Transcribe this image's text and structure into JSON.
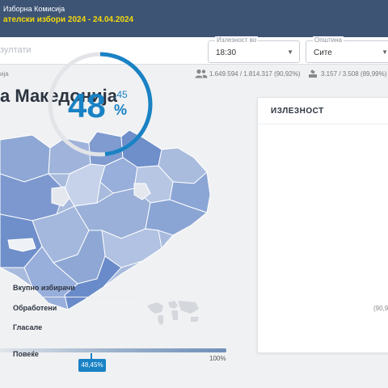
{
  "header": {
    "org": "Изборна Комисија",
    "election": "ателски избори 2024 - 24.04.2024"
  },
  "toolbar": {
    "results_label": "зултати",
    "turnout_select": {
      "label": "Излезност во",
      "value": "18:30"
    },
    "municipality_select": {
      "label": "Општина",
      "value": "Сите"
    }
  },
  "stats": {
    "region": "ија",
    "voters": "1.649.594 / 1.814.317 (90,92%)",
    "stations": "3.157 / 3.508 (89,99%)",
    "icons": [
      "people-icon",
      "ballot-box-icon"
    ]
  },
  "page_title": "а Македонија",
  "legend": {
    "max_label": "100%",
    "current_value": "48,45%",
    "current_fraction": 0.4845
  },
  "turnout_card": {
    "title": "ИЗЛЕЗНОСТ",
    "percent_int": "48",
    "percent_dec": ",45",
    "percent_sign": "%",
    "percent_value": 48.45,
    "rows": [
      {
        "label": "Вкупно избирачи",
        "value": ""
      },
      {
        "label": "Обработени",
        "value": "(90,9"
      },
      {
        "label": "Гласале",
        "value": ""
      },
      {
        "label": "Повеќе",
        "value": ""
      }
    ]
  },
  "colors": {
    "topbar": "#3d5475",
    "accent": "#1982c4",
    "election_title": "#f5d90a",
    "map_light": "#c9d4e6",
    "map_dark": "#6f8fca"
  }
}
